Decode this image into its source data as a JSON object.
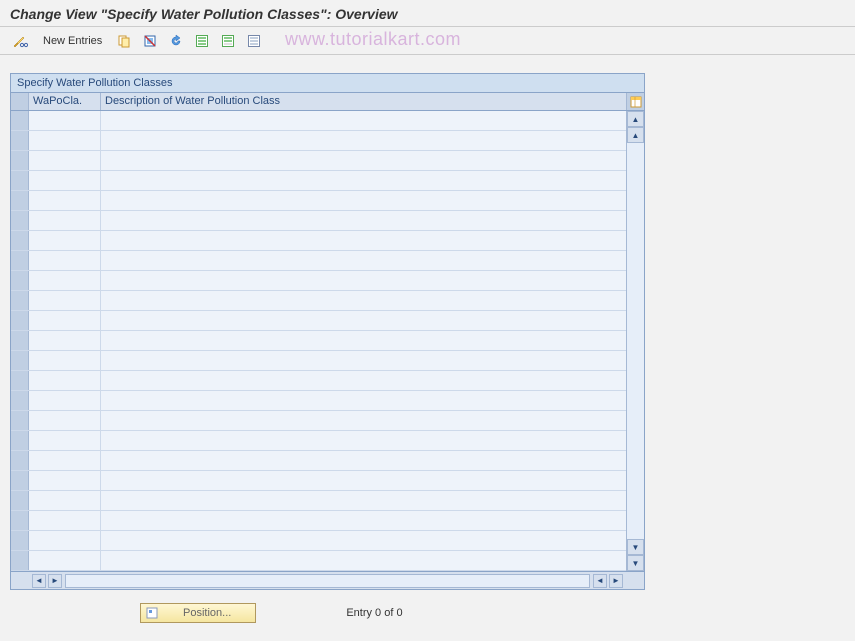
{
  "page_title": "Change View \"Specify Water Pollution Classes\": Overview",
  "toolbar": {
    "new_entries_label": "New Entries"
  },
  "watermark": "www.tutorialkart.com",
  "panel": {
    "title": "Specify Water Pollution Classes",
    "columns": {
      "col1": "WaPoCla.",
      "col2": "Description of Water Pollution Class"
    },
    "row_count": 23
  },
  "footer": {
    "position_label": "Position...",
    "entry_text": "Entry 0 of 0"
  }
}
